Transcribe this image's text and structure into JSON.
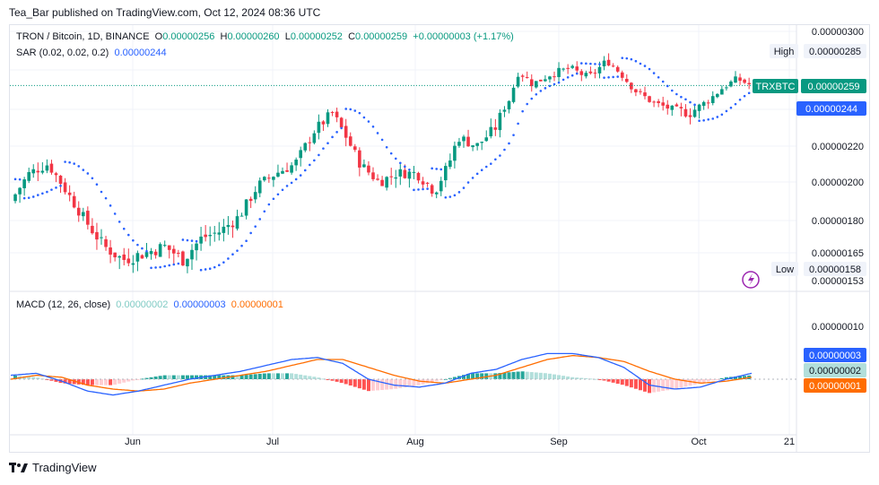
{
  "header": {
    "published": "Tea_Bar published on TradingView.com, Oct 12, 2024 08:36 UTC"
  },
  "legend": {
    "symbol": "TRON / Bitcoin, 1D, BINANCE",
    "o_label": "O",
    "o": "0.00000256",
    "h_label": "H",
    "h": "0.00000260",
    "l_label": "L",
    "l": "0.00000252",
    "c_label": "C",
    "c": "0.00000259",
    "change": "+0.00000003 (+1.17%)",
    "sar_label": "SAR (0.02, 0.02, 0.2)",
    "sar_value": "0.00000244",
    "macd_label": "MACD (12, 26, close)",
    "macd_hist": "0.00000002",
    "macd_line": "0.00000003",
    "macd_signal": "0.00000001"
  },
  "price_axis": {
    "ticks": [
      "0.00000300",
      "0.00000260",
      "0.00000240",
      "0.00000220",
      "0.00000200",
      "0.00000180",
      "0.00000165",
      "0.00000153"
    ],
    "high_label": "High",
    "high_value": "0.00000285",
    "low_label": "Low",
    "low_value": "0.00000158",
    "symbol_tag": "TRXBTC",
    "last_price": "0.00000259",
    "sar_tag": "0.00000244"
  },
  "macd_axis": {
    "ticks": [
      "0.00000010"
    ],
    "tag_macd": "0.00000003",
    "tag_hist": "0.00000002",
    "tag_signal": "0.00000001"
  },
  "time_axis": [
    "Jun",
    "Jul",
    "Aug",
    "Sep",
    "Oct",
    "21"
  ],
  "brand": "TradingView",
  "colors": {
    "up": "#089981",
    "down": "#f23645",
    "sar": "#2962ff",
    "macd_line": "#2962ff",
    "signal_line": "#ff6d00",
    "hist_up_strong": "#26a69a",
    "hist_up_weak": "#b2dfdb",
    "hist_down_strong": "#ff5252",
    "hist_down_weak": "#ffcdd2"
  },
  "chart_data": [
    {
      "type": "candlestick",
      "title": "TRON / Bitcoin, 1D, BINANCE",
      "ylim": [
        1.5e-06,
        3e-06
      ],
      "x_labels": [
        "Jun",
        "Jul",
        "Aug",
        "Sep",
        "Oct",
        "21"
      ],
      "close_path": [
        {
          "date": "2024-05-06",
          "close": 1.9e-06
        },
        {
          "date": "2024-05-10",
          "close": 2.05e-06
        },
        {
          "date": "2024-05-14",
          "close": 2.1e-06
        },
        {
          "date": "2024-05-18",
          "close": 1.95e-06
        },
        {
          "date": "2024-05-22",
          "close": 1.8e-06
        },
        {
          "date": "2024-05-26",
          "close": 1.68e-06
        },
        {
          "date": "2024-05-30",
          "close": 1.62e-06
        },
        {
          "date": "2024-06-04",
          "close": 1.65e-06
        },
        {
          "date": "2024-06-08",
          "close": 1.68e-06
        },
        {
          "date": "2024-06-12",
          "close": 1.62e-06
        },
        {
          "date": "2024-06-16",
          "close": 1.72e-06
        },
        {
          "date": "2024-06-20",
          "close": 1.75e-06
        },
        {
          "date": "2024-06-24",
          "close": 1.82e-06
        },
        {
          "date": "2024-06-28",
          "close": 1.98e-06
        },
        {
          "date": "2024-07-02",
          "close": 2.05e-06
        },
        {
          "date": "2024-07-06",
          "close": 2.1e-06
        },
        {
          "date": "2024-07-10",
          "close": 2.28e-06
        },
        {
          "date": "2024-07-14",
          "close": 2.38e-06
        },
        {
          "date": "2024-07-17",
          "close": 2.25e-06
        },
        {
          "date": "2024-07-20",
          "close": 2.1e-06
        },
        {
          "date": "2024-07-24",
          "close": 2e-06
        },
        {
          "date": "2024-07-28",
          "close": 2.05e-06
        },
        {
          "date": "2024-08-01",
          "close": 2.05e-06
        },
        {
          "date": "2024-08-05",
          "close": 1.95e-06
        },
        {
          "date": "2024-08-08",
          "close": 2.1e-06
        },
        {
          "date": "2024-08-10",
          "close": 2.25e-06
        },
        {
          "date": "2024-08-14",
          "close": 2.2e-06
        },
        {
          "date": "2024-08-18",
          "close": 2.3e-06
        },
        {
          "date": "2024-08-21",
          "close": 2.48e-06
        },
        {
          "date": "2024-08-23",
          "close": 2.7e-06
        },
        {
          "date": "2024-08-26",
          "close": 2.6e-06
        },
        {
          "date": "2024-08-30",
          "close": 2.68e-06
        },
        {
          "date": "2024-09-03",
          "close": 2.72e-06
        },
        {
          "date": "2024-09-07",
          "close": 2.65e-06
        },
        {
          "date": "2024-09-11",
          "close": 2.78e-06
        },
        {
          "date": "2024-09-14",
          "close": 2.68e-06
        },
        {
          "date": "2024-09-17",
          "close": 2.55e-06
        },
        {
          "date": "2024-09-21",
          "close": 2.45e-06
        },
        {
          "date": "2024-09-25",
          "close": 2.4e-06
        },
        {
          "date": "2024-09-29",
          "close": 2.38e-06
        },
        {
          "date": "2024-10-03",
          "close": 2.48e-06
        },
        {
          "date": "2024-10-06",
          "close": 2.58e-06
        },
        {
          "date": "2024-10-09",
          "close": 2.64e-06
        },
        {
          "date": "2024-10-12",
          "close": 2.59e-06
        }
      ]
    },
    {
      "type": "line",
      "title": "MACD (12, 26, close)",
      "series": [
        {
          "values": [
            2e-08,
            3e-08,
            -1e-08,
            -6e-08,
            -8e-08,
            -6e-08,
            -3e-08,
            0.0,
            2e-08,
            4e-08,
            7e-08,
            1e-07,
            1.1e-07,
            8e-08,
            0.0,
            -3e-08,
            -4e-08,
            -2e-08,
            3e-08,
            5e-08,
            1e-07,
            1.3e-07,
            1.3e-07,
            1.1e-07,
            6e-08,
            -3e-08,
            -5e-08,
            -4e-08,
            0.0,
            3e-08
          ]
        },
        {
          "values": [
            0.0,
            2e-08,
            1e-08,
            -3e-08,
            -5e-08,
            -6e-08,
            -5e-08,
            -2e-08,
            0.0,
            2e-08,
            4e-08,
            7e-08,
            1e-07,
            1e-07,
            6e-08,
            2e-08,
            -1e-08,
            -2e-08,
            0.0,
            2e-08,
            6e-08,
            1e-07,
            1.2e-07,
            1.1e-07,
            9e-08,
            4e-08,
            0.0,
            -2e-08,
            -1e-08,
            1e-08
          ]
        }
      ]
    }
  ]
}
